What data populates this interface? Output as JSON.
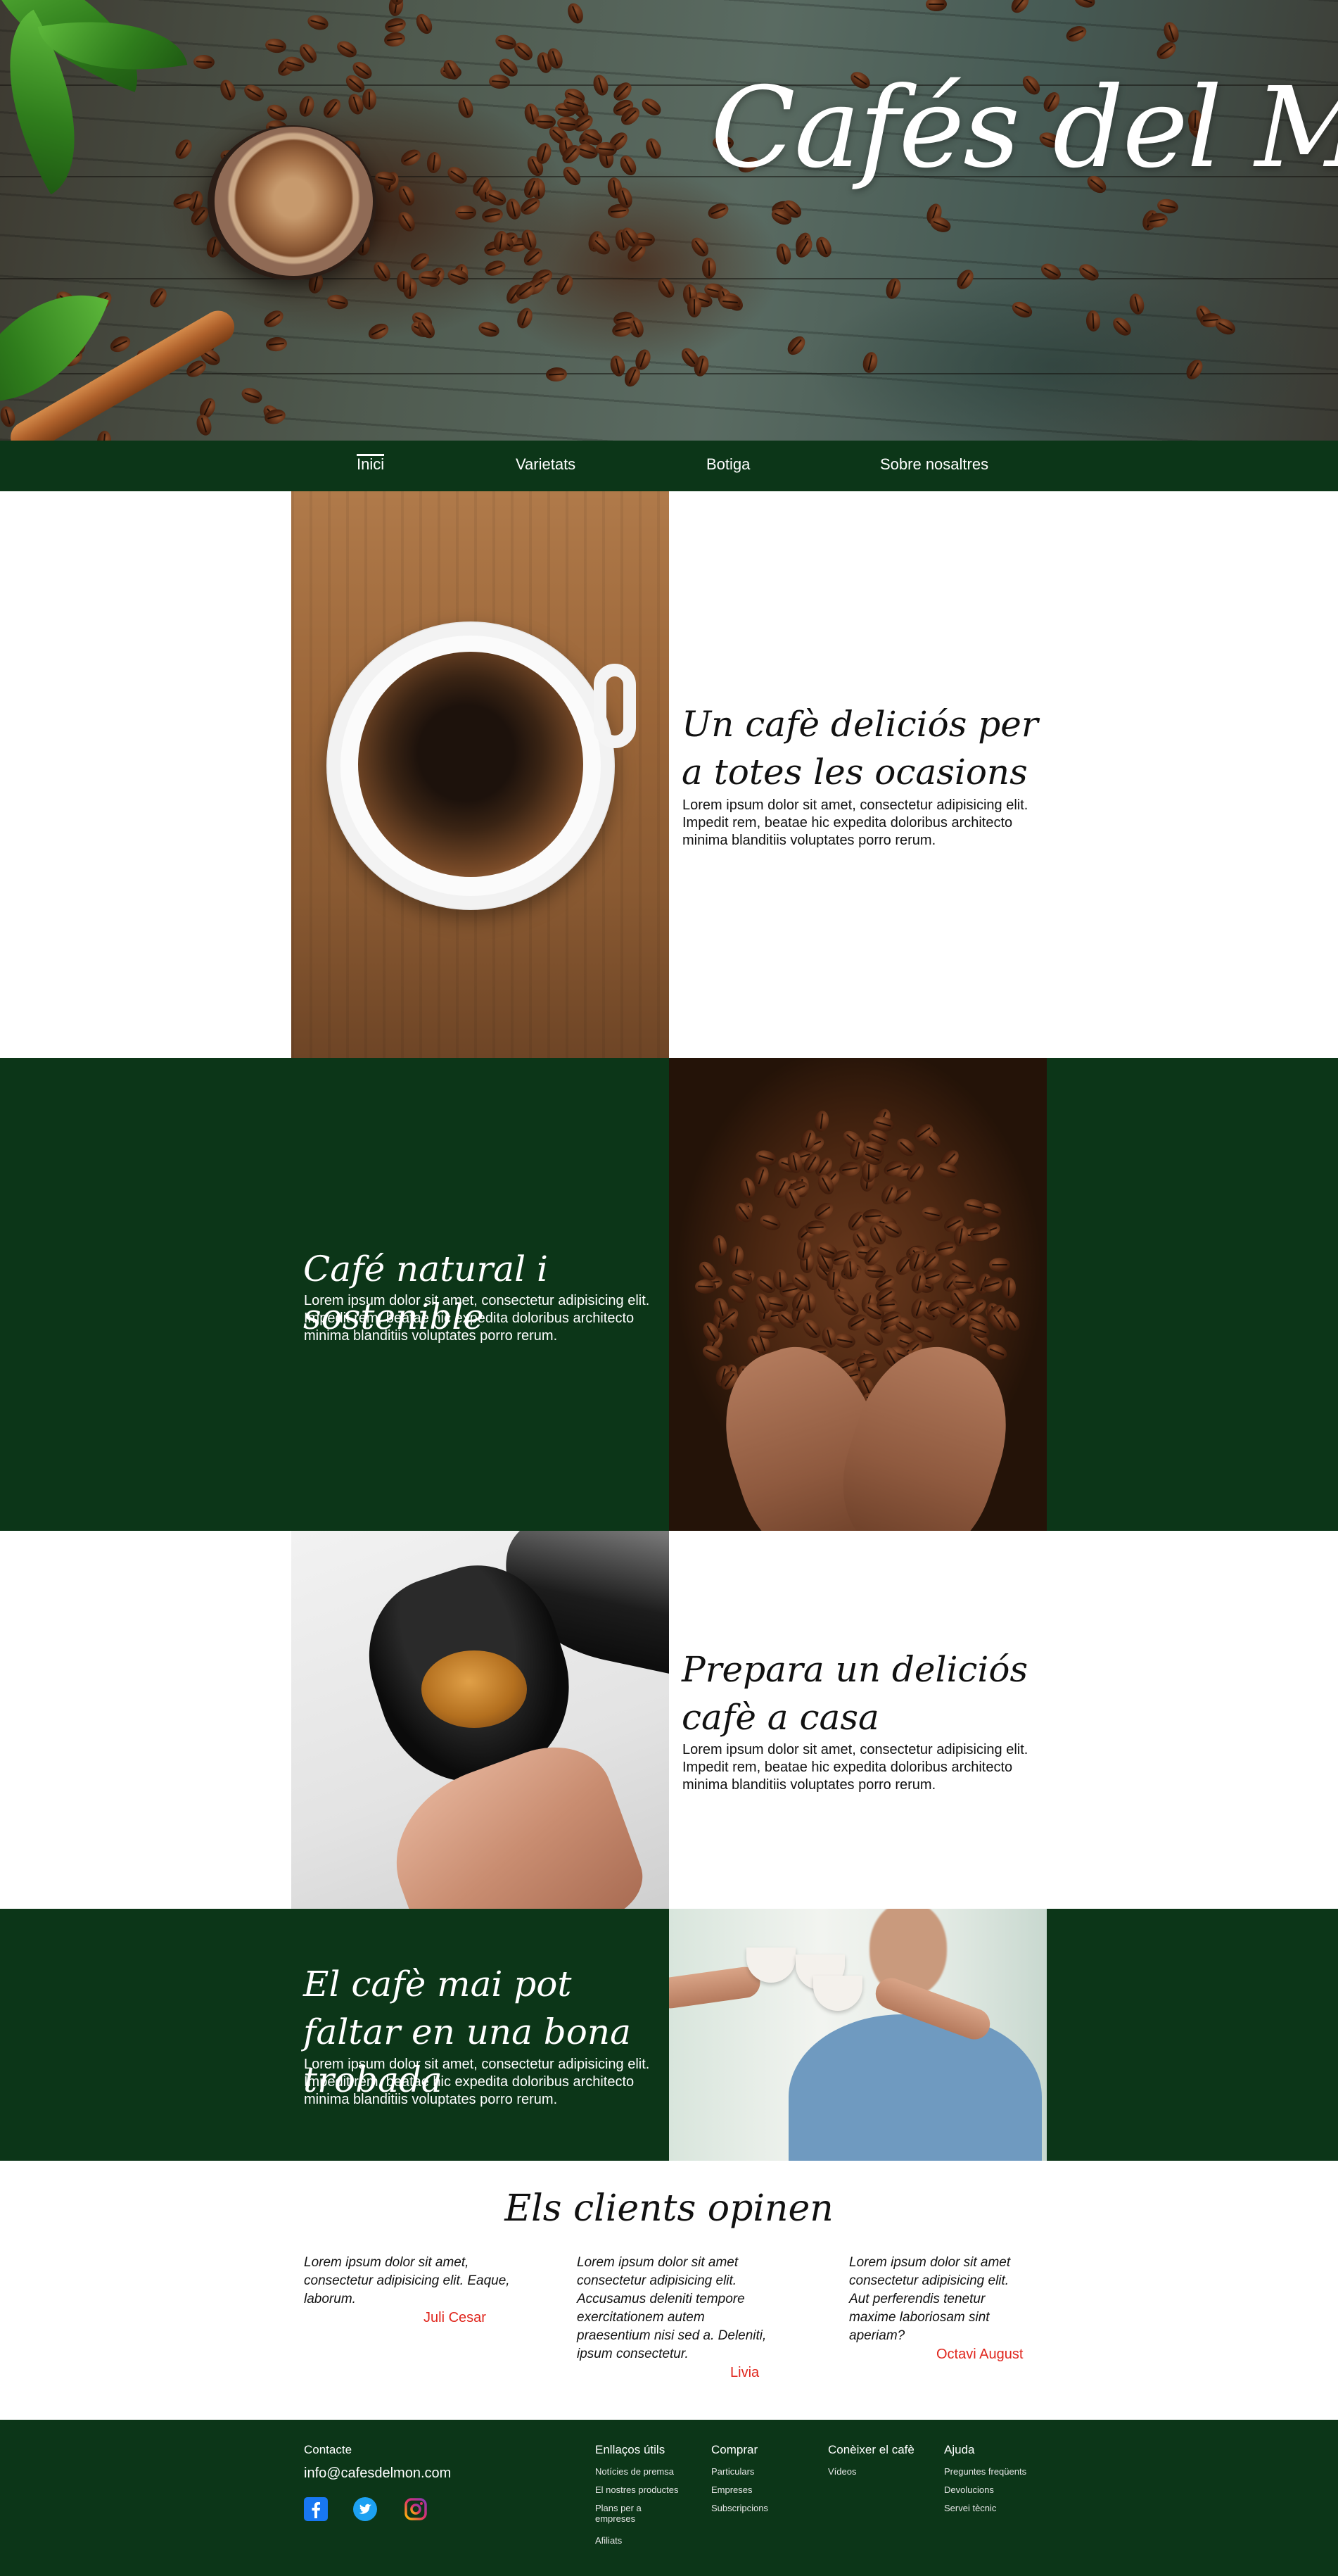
{
  "hero": {
    "title": "Cafés del Món"
  },
  "nav": {
    "items": [
      {
        "label": "Inici",
        "active": true
      },
      {
        "label": "Varietats",
        "active": false
      },
      {
        "label": "Botiga",
        "active": false
      },
      {
        "label": "Sobre nosaltres",
        "active": false
      }
    ]
  },
  "features": [
    {
      "title": "Un cafè deliciós per a totes les ocasions",
      "body": "Lorem ipsum dolor sit amet, consectetur adipisicing elit. Impedit rem, beatae hic expedita doloribus architecto minima blanditiis voluptates porro rerum."
    },
    {
      "title": "Café natural i sostenible",
      "body": "Lorem ipsum dolor sit amet, consectetur adipisicing elit. Impedit rem, beatae hic expedita doloribus architecto minima blanditiis voluptates porro rerum."
    },
    {
      "title": "Prepara un deliciós cafè a casa",
      "body": "Lorem ipsum dolor sit amet, consectetur adipisicing elit. Impedit rem, beatae hic expedita doloribus architecto minima blanditiis voluptates porro rerum."
    },
    {
      "title": "El cafè mai pot faltar en una bona trobada",
      "body": "Lorem ipsum dolor sit amet, consectetur adipisicing elit. Impedit rem, beatae hic expedita doloribus architecto minima blanditiis voluptates porro rerum."
    }
  ],
  "testimonials": {
    "title": "Els clients opinen",
    "items": [
      {
        "text": "Lorem ipsum dolor sit amet, consectetur adipisicing elit. Eaque, laborum.",
        "author": "Juli Cesar"
      },
      {
        "text": "Lorem ipsum dolor sit amet consectetur adipisicing elit. Accusamus deleniti tempore exercitationem autem praesentium nisi sed a. Deleniti, ipsum consectetur.",
        "author": "Livia"
      },
      {
        "text": "Lorem ipsum dolor sit amet consectetur adipisicing elit. Aut perferendis tenetur maxime laboriosam sint aperiam?",
        "author": "Octavi August"
      }
    ]
  },
  "footer": {
    "contact_heading": "Contacte",
    "email": "info@cafesdelmon.com",
    "social_icons": [
      "facebook-icon",
      "twitter-icon",
      "instagram-icon"
    ],
    "colors": {
      "facebook": "#1877f2",
      "twitter": "#1da1f2",
      "instagram": "#e1306c",
      "accent_green": "#0c3618",
      "author_red": "#e0261d"
    },
    "columns": [
      {
        "heading": "Enllaços útils",
        "links": [
          "Notícies de premsa",
          "El nostres productes",
          "Plans per a empreses",
          "Afiliats"
        ]
      },
      {
        "heading": "Comprar",
        "links": [
          "Particulars",
          "Empreses",
          "Subscripcions"
        ]
      },
      {
        "heading": "Conèixer el cafè",
        "links": [
          "Vídeos"
        ]
      },
      {
        "heading": "Ajuda",
        "links": [
          "Preguntes freqüents",
          "Devolucions",
          "Servei tècnic"
        ]
      }
    ]
  }
}
